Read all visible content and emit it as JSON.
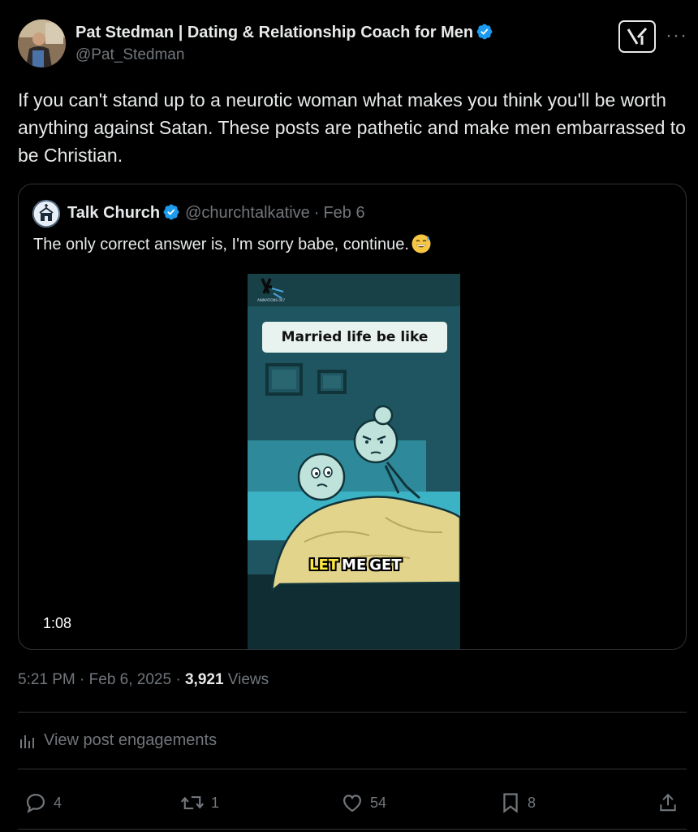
{
  "post": {
    "author_name": "Pat Stedman | Dating & Relationship Coach for Men",
    "author_handle": "@Pat_Stedman",
    "text": "If you can't stand up to a neurotic woman what makes you think you'll be worth anything against Satan. These posts are pathetic and make men embarrassed to be Christian.",
    "time": "5:21 PM",
    "date": "Feb 6, 2025",
    "views_count": "3,921",
    "views_label": "Views"
  },
  "quoted": {
    "name": "Talk Church",
    "handle": "@churchtalkative",
    "date": "Feb 6",
    "text": "The only correct answer is, I'm sorry babe, continue.",
    "video": {
      "title_overlay": "Married life be like",
      "caption_words": [
        "LET",
        "ME",
        "GET"
      ],
      "duration": "1:08"
    }
  },
  "engagements_label": "View post engagements",
  "actions": {
    "replies": "4",
    "reposts": "1",
    "likes": "54",
    "bookmarks": "8"
  },
  "colors": {
    "background": "#000000",
    "text_primary": "#e7e9ea",
    "text_secondary": "#71767b",
    "border": "#2f3336",
    "verified": "#1d9bf0"
  }
}
